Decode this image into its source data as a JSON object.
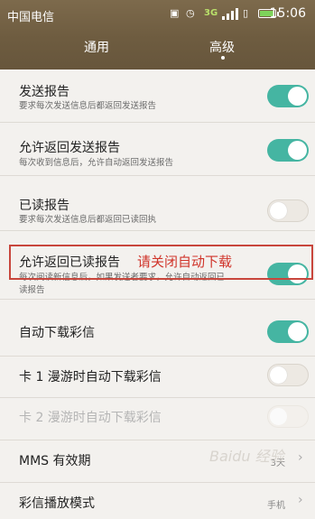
{
  "status_bar": {
    "carrier": "中国电信",
    "network": "3G",
    "time": "15:06"
  },
  "tabs": [
    {
      "label": "通用",
      "active": false
    },
    {
      "label": "高级",
      "active": true
    }
  ],
  "settings": [
    {
      "title": "发送报告",
      "subtitle": "要求每次发送信息后都返回发送报告",
      "toggle": "on"
    },
    {
      "title": "允许返回发送报告",
      "subtitle": "每次收到信息后，允许自动返回发送报告",
      "toggle": "on"
    },
    {
      "title": "已读报告",
      "subtitle": "要求每次发送信息后都返回已读回执",
      "toggle": "off"
    },
    {
      "title": "允许返回已读报告",
      "subtitle_line1": "每次阅读新信息后，如果发送者要求，允许自动返回已",
      "subtitle_line2": "读报告",
      "toggle": "on"
    },
    {
      "title": "自动下载彩信",
      "toggle": "on"
    },
    {
      "title": "卡 1 漫游时自动下载彩信",
      "toggle": "off"
    },
    {
      "title": "卡 2 漫游时自动下载彩信",
      "toggle": "disabled"
    },
    {
      "title": "MMS 有效期",
      "value": "3天"
    },
    {
      "title": "彩信播放模式",
      "value": "手机"
    }
  ],
  "annotation": "请关闭自动下载",
  "watermark": "Baidu 经验",
  "colors": {
    "accent": "#45b5a2",
    "header": "#6e5c40",
    "annotation": "#d0342a"
  }
}
